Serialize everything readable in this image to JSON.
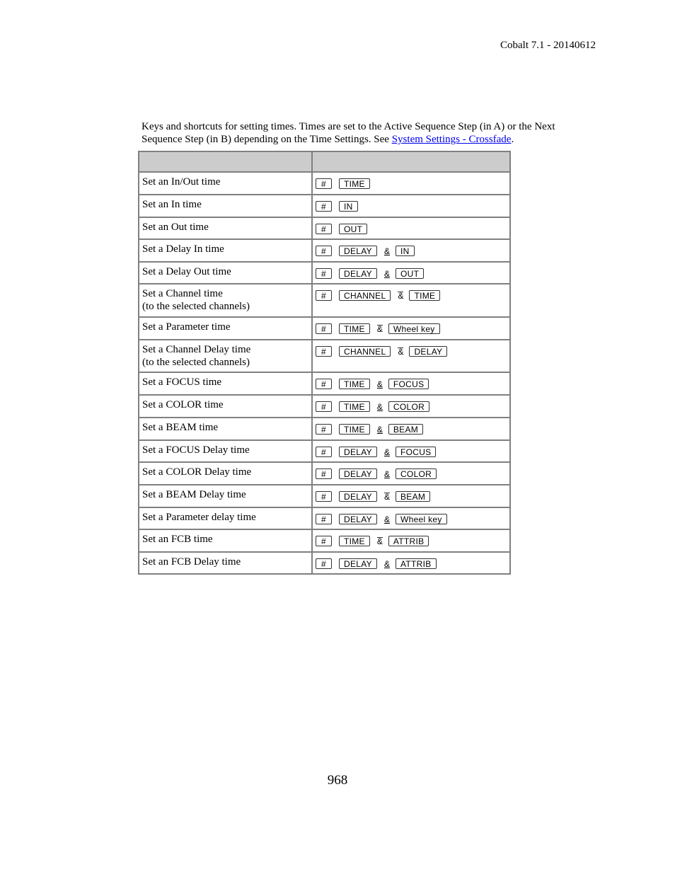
{
  "document": {
    "running_header": "Cobalt 7.1 - 20140612",
    "intro_text": "Keys and shortcuts for setting times. Times are set to the Active Sequence Step (in A) or the Next Sequence Step (in B) depending on the Time Settings. See ",
    "intro_link": "System Settings - Crossfade",
    "intro_end": ".",
    "page_number": "968"
  },
  "table": {
    "headers": [
      "",
      ""
    ],
    "rows": [
      {
        "action": "Set an In/Out time",
        "keys": [
          "#",
          "TIME"
        ]
      },
      {
        "action": "Set an In time",
        "keys": [
          "#",
          "IN"
        ]
      },
      {
        "action": "Set an Out time",
        "keys": [
          "#",
          "OUT"
        ]
      },
      {
        "action": "Set a Delay In time",
        "keys": [
          "#",
          "DELAY",
          "&",
          "IN"
        ]
      },
      {
        "action": "Set a Delay Out time",
        "keys": [
          "#",
          "DELAY",
          "&",
          "OUT"
        ]
      },
      {
        "action": "Set a Channel time",
        "note": "(to the selected channels)",
        "keys": [
          "#",
          "CHANNEL",
          "&",
          "TIME"
        ]
      },
      {
        "action": "Set a Parameter time",
        "keys": [
          "#",
          "TIME",
          "&",
          "Wheel key"
        ]
      },
      {
        "action": "Set a Channel Delay time",
        "note": "(to the selected channels)",
        "keys": [
          "#",
          "CHANNEL",
          "&",
          "DELAY"
        ]
      },
      {
        "action": "Set a FOCUS time",
        "keys": [
          "#",
          "TIME",
          "&",
          "FOCUS"
        ]
      },
      {
        "action": "Set a COLOR time",
        "keys": [
          "#",
          "TIME",
          "&",
          "COLOR"
        ]
      },
      {
        "action": "Set a BEAM time",
        "keys": [
          "#",
          "TIME",
          "&",
          "BEAM"
        ]
      },
      {
        "action": "Set a FOCUS Delay time",
        "keys": [
          "#",
          "DELAY",
          "&",
          "FOCUS"
        ]
      },
      {
        "action": "Set a COLOR Delay time",
        "keys": [
          "#",
          "DELAY",
          "&",
          "COLOR"
        ]
      },
      {
        "action": "Set a BEAM Delay time",
        "keys": [
          "#",
          "DELAY",
          "&",
          "BEAM"
        ]
      },
      {
        "action": "Set a Parameter delay time",
        "keys": [
          "#",
          "DELAY",
          "&",
          "Wheel key"
        ]
      },
      {
        "action": "Set an FCB time",
        "keys": [
          "#",
          "TIME",
          "&",
          "ATTRIB"
        ]
      },
      {
        "action": "Set an FCB Delay time",
        "keys": [
          "#",
          "DELAY",
          "&",
          "ATTRIB"
        ]
      }
    ]
  },
  "colors": {
    "link": "#0000ee",
    "table_header_bg": "#cccccc",
    "table_border": "#808080"
  }
}
